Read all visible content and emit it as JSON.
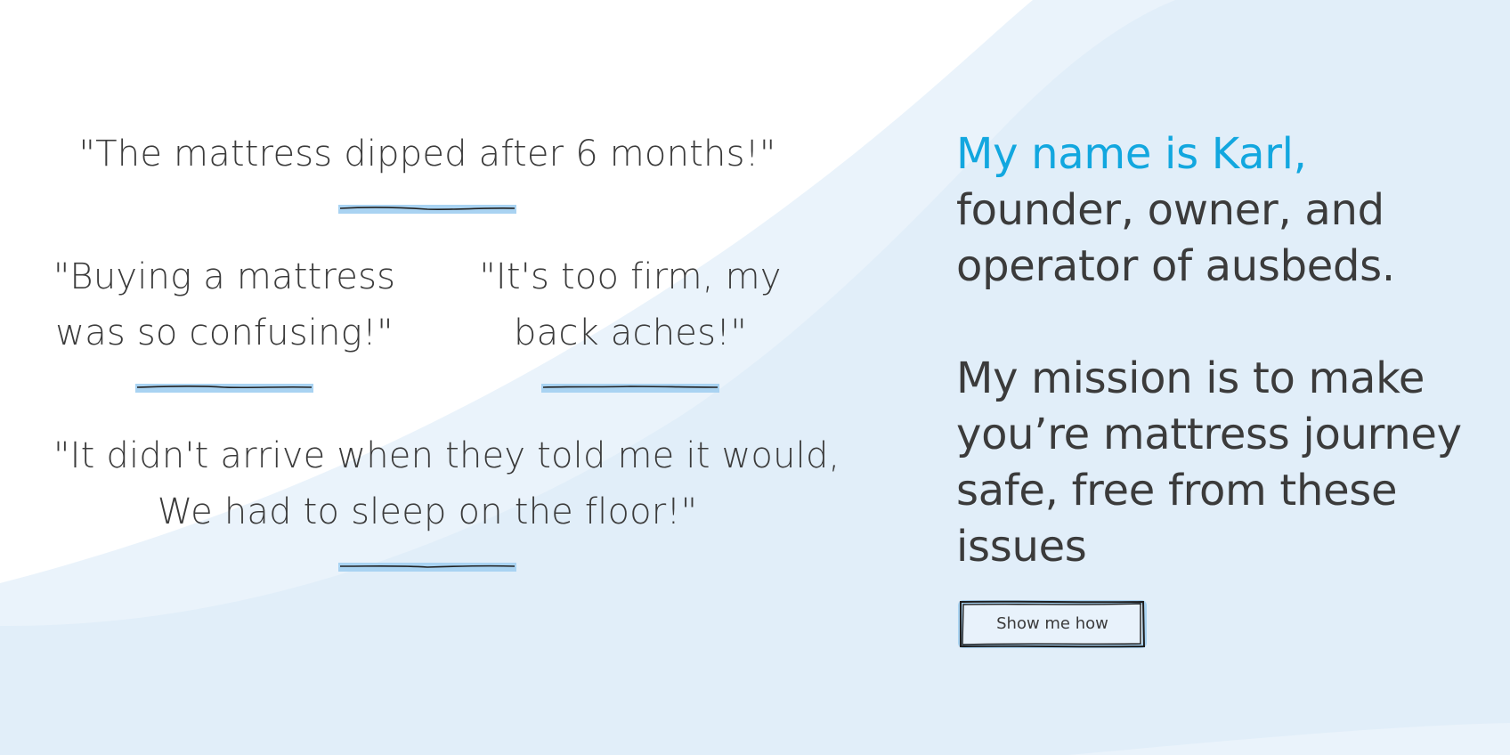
{
  "quotes": {
    "q1": "\"The mattress dipped after 6 months!\"",
    "q2_line1": "\"Buying a mattress",
    "q2_line2": "was so confusing!\"",
    "q3_line1": "\"It's too firm, my",
    "q3_line2": "back aches!\"",
    "q4_line1": "\"It didn't arrive when they told me it would,",
    "q4_line2": "We had to sleep on the floor!\""
  },
  "intro": {
    "accent": "My name is Karl,",
    "line2": "founder, owner, and",
    "line3": "operator of ausbeds.",
    "mission_line1": "My mission is to make",
    "mission_line2": "you’re mattress journey",
    "mission_line3": "safe, free from these",
    "mission_line4": "issues"
  },
  "cta": {
    "label": "Show me how"
  },
  "colors": {
    "accent": "#12a7df",
    "text": "#3b3b3b",
    "wave_light": "#eaf3fb",
    "wave_main": "#e1eef9",
    "highlight": "#a9d3f2"
  }
}
